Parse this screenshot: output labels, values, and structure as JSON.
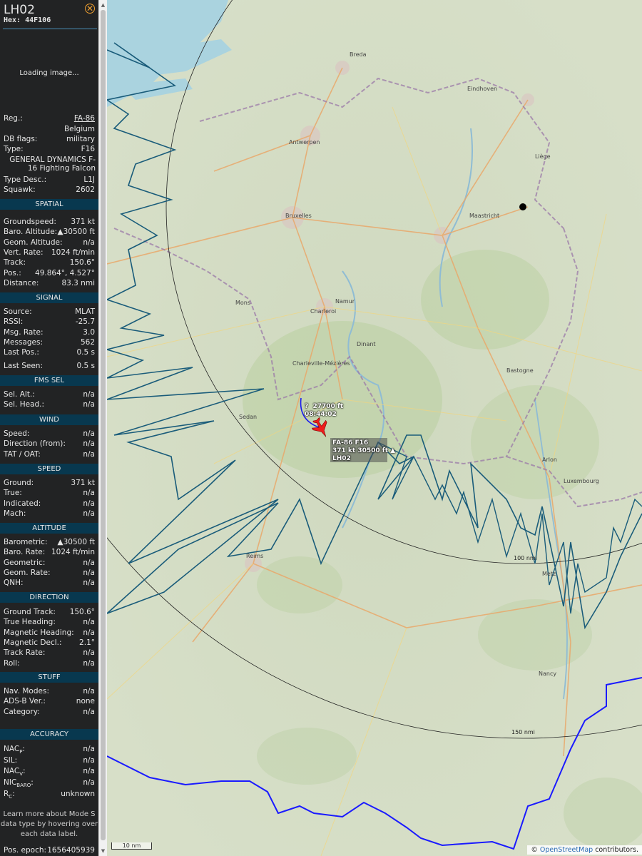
{
  "header": {
    "callsign": "LH02",
    "hex": "Hex: 44F106",
    "loading": "Loading image..."
  },
  "info": {
    "reg_label": "Reg.:",
    "reg_value": "FA-86",
    "country": "Belgium",
    "dbflags_label": "DB flags:",
    "dbflags_value": "military",
    "type_label": "Type:",
    "type_value": "F16",
    "type_name": "GENERAL DYNAMICS F-16 Fighting Falcon",
    "typedesc_label": "Type Desc.:",
    "typedesc_value": "L1J",
    "squawk_label": "Squawk:",
    "squawk_value": "2602"
  },
  "sections": {
    "spatial": "SPATIAL",
    "signal": "SIGNAL",
    "fmssel": "FMS SEL",
    "wind": "WIND",
    "speed": "SPEED",
    "altitude": "ALTITUDE",
    "direction": "DIRECTION",
    "stuff": "STUFF",
    "accuracy": "ACCURACY"
  },
  "spatial": [
    {
      "k": "Groundspeed:",
      "v": "371 kt"
    },
    {
      "k": "Baro. Altitude:",
      "v": "▲30500 ft"
    },
    {
      "k": "Geom. Altitude:",
      "v": "n/a"
    },
    {
      "k": "Vert. Rate:",
      "v": "1024 ft/min"
    },
    {
      "k": "Track:",
      "v": "150.6°"
    },
    {
      "k": "Pos.:",
      "v": "49.864°, 4.527°"
    },
    {
      "k": "Distance:",
      "v": "83.3 nmi"
    }
  ],
  "signal": [
    {
      "k": "Source:",
      "v": "MLAT"
    },
    {
      "k": "RSSI:",
      "v": "-25.7"
    },
    {
      "k": "Msg. Rate:",
      "v": "3.0"
    },
    {
      "k": "Messages:",
      "v": "562"
    },
    {
      "k": "Last Pos.:",
      "v": "0.5 s"
    },
    {
      "k": "Last Seen:",
      "v": "0.5 s"
    }
  ],
  "fmssel": [
    {
      "k": "Sel. Alt.:",
      "v": "n/a"
    },
    {
      "k": "Sel. Head.:",
      "v": "n/a"
    }
  ],
  "wind": [
    {
      "k": "Speed:",
      "v": "n/a"
    },
    {
      "k": "Direction (from):",
      "v": "n/a"
    },
    {
      "k": "TAT / OAT:",
      "v": "n/a"
    }
  ],
  "speed": [
    {
      "k": "Ground:",
      "v": "371 kt"
    },
    {
      "k": "True:",
      "v": "n/a"
    },
    {
      "k": "Indicated:",
      "v": "n/a"
    },
    {
      "k": "Mach:",
      "v": "n/a"
    }
  ],
  "altitude": [
    {
      "k": "Barometric:",
      "v": "▲30500 ft"
    },
    {
      "k": "Baro. Rate:",
      "v": "1024 ft/min"
    },
    {
      "k": "Geometric:",
      "v": "n/a"
    },
    {
      "k": "Geom. Rate:",
      "v": "n/a"
    },
    {
      "k": "QNH:",
      "v": "n/a"
    }
  ],
  "direction": [
    {
      "k": "Ground Track:",
      "v": "150.6°"
    },
    {
      "k": "True Heading:",
      "v": "n/a"
    },
    {
      "k": "Magnetic Heading:",
      "v": "n/a"
    },
    {
      "k": "Magnetic Decl.:",
      "v": "2.1°"
    },
    {
      "k": "Track Rate:",
      "v": "n/a"
    },
    {
      "k": "Roll:",
      "v": "n/a"
    }
  ],
  "stuff": [
    {
      "k": "Nav. Modes:",
      "v": "n/a"
    },
    {
      "k": "ADS-B Ver.:",
      "v": "none"
    },
    {
      "k": "Category:",
      "v": "n/a"
    }
  ],
  "accuracy": {
    "nacp_k": "NAC",
    "nacp_sub": "P",
    "nacp_v": "n/a",
    "sil_k": "SIL:",
    "sil_v": "n/a",
    "nacv_k": "NAC",
    "nacv_sub": "V",
    "nacv_v": "n/a",
    "nic_k": "NIC",
    "nic_sub": "BARO",
    "nic_v": "n/a",
    "rc_k": "R",
    "rc_sub": "C",
    "rc_v": "unknown"
  },
  "note": "Learn more about Mode S data type by hovering over each data label.",
  "epoch": {
    "k": "Pos. epoch:",
    "v": "1656405939"
  },
  "map": {
    "label_line1": "FA-86 F16",
    "label_line2": "371 kt 30500 ft ▲",
    "label_line3": "LH02",
    "hist_label_q": "?",
    "hist_label_alt": "27700 ft",
    "hist_label_time": "08:44:02",
    "ring_100": "100 nmi",
    "ring_150": "150 nmi",
    "scale": "10 nm",
    "attribution_prefix": "© ",
    "attribution_link": "OpenStreetMap",
    "attribution_suffix": " contributors.",
    "cities": [
      "Antwerpen",
      "Bruxelles",
      "Liège",
      "Maastricht",
      "Namur",
      "Charleroi",
      "Luxembourg",
      "Reims",
      "Dinant",
      "Eindhoven",
      "Breda",
      "Mons",
      "Nancy",
      "Metz",
      "Sedan",
      "Charleville-Mézières",
      "Bastogne",
      "Arlon"
    ],
    "colors": {
      "track": "#1a5c7a",
      "border": "#1a1aff",
      "aircraft": "#ee1c1c",
      "sidebar": "#222324",
      "section": "#08384f"
    }
  }
}
